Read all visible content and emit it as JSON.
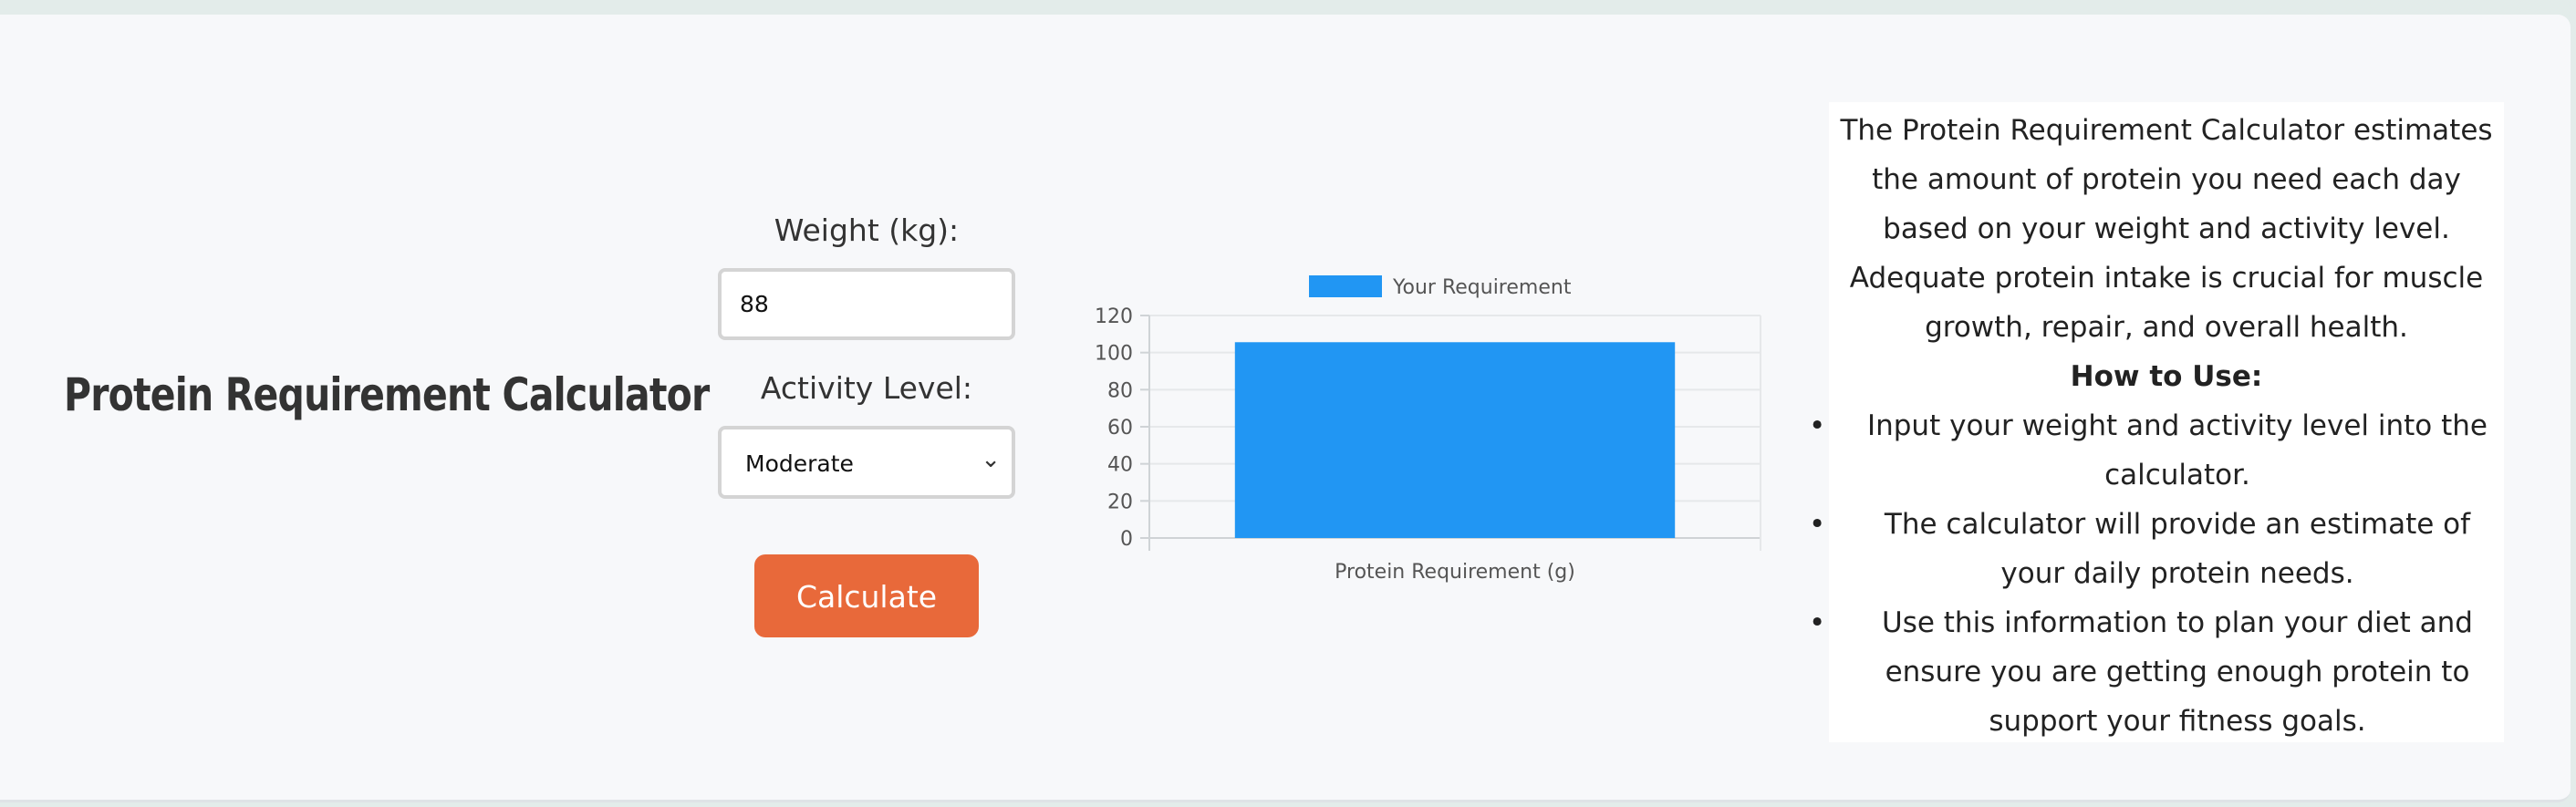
{
  "app": {
    "title": "Protein Requirement Calculator"
  },
  "form": {
    "weight_label": "Weight (kg):",
    "weight_value": "88",
    "activity_label": "Activity Level:",
    "activity_selected": "Moderate",
    "calculate_label": "Calculate",
    "button_color": "#e8693a"
  },
  "chart_data": {
    "type": "bar",
    "categories": [
      "Protein Requirement (g)"
    ],
    "series": [
      {
        "name": "Your Requirement",
        "values": [
          105.6
        ],
        "color": "#2196f3"
      }
    ],
    "ylim": [
      0,
      120
    ],
    "yticks": [
      "120",
      "100",
      "80",
      "60",
      "40",
      "20",
      "0"
    ],
    "grid": true,
    "legend": "top"
  },
  "description": {
    "intro": "The Protein Requirement Calculator estimates the amount of protein you need each day based on your weight and activity level. Adequate protein intake is crucial for muscle growth, repair, and overall health.",
    "howto_heading": "How to Use:",
    "steps": [
      "Input your weight and activity level into the calculator.",
      "The calculator will provide an estimate of your daily protein needs.",
      "Use this information to plan your diet and ensure you are getting enough protein to support your fitness goals."
    ]
  }
}
